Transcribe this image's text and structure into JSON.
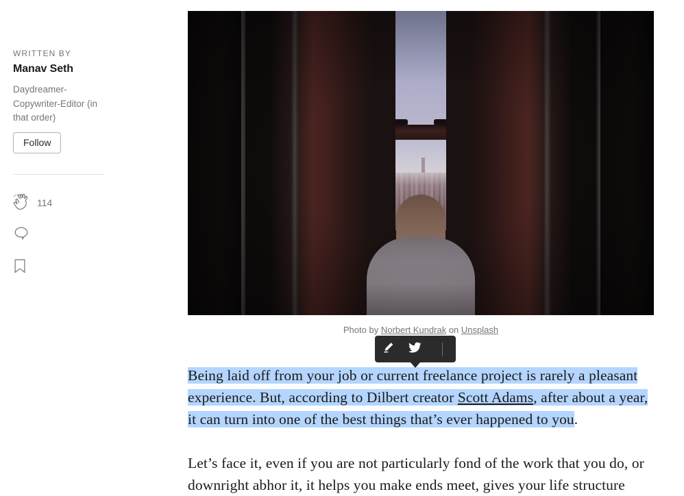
{
  "sidebar": {
    "written_by_label": "WRITTEN BY",
    "author_name": "Manav Seth",
    "author_bio": "Daydreamer-Copywriter-Editor (in that order)",
    "follow_label": "Follow",
    "clap_count": "114",
    "icons": {
      "clap": "clap-icon",
      "responses": "comment-bubble-icon",
      "bookmark": "bookmark-icon"
    }
  },
  "hero": {
    "alt": "Man in grey hoodie looking out of an apartment window onto the Manhattan skyline at dusk",
    "caption_prefix": "Photo by ",
    "caption_photographer": "Norbert Kundrak",
    "caption_middle": " on ",
    "caption_source": "Unsplash"
  },
  "selection_tooltip": {
    "highlight_icon": "highlighter-pen-icon",
    "twitter_icon": "twitter-bird-icon",
    "background_color": "#2b2b2b"
  },
  "article": {
    "paragraph_1_highlighted": "Being laid off from your job or current freelance project is rarely a pleasant experience. But, according to Dilbert creator ",
    "paragraph_1_link": "Scott Adams",
    "paragraph_1_highlighted_2": ", after about a year, it can turn into one of the best things that’s ever happened to you",
    "paragraph_1_tail": ".",
    "paragraph_2": "Let’s face it, even if you are not particularly fond of the work that you do, or downright abhor it, it helps you make ends meet, gives your life structure"
  },
  "colors": {
    "selection_highlight": "#b4d5fe",
    "muted_text": "#757575",
    "body_text": "#1a1a1a",
    "border": "#b3b3b3",
    "divider": "#e0e0e0"
  }
}
